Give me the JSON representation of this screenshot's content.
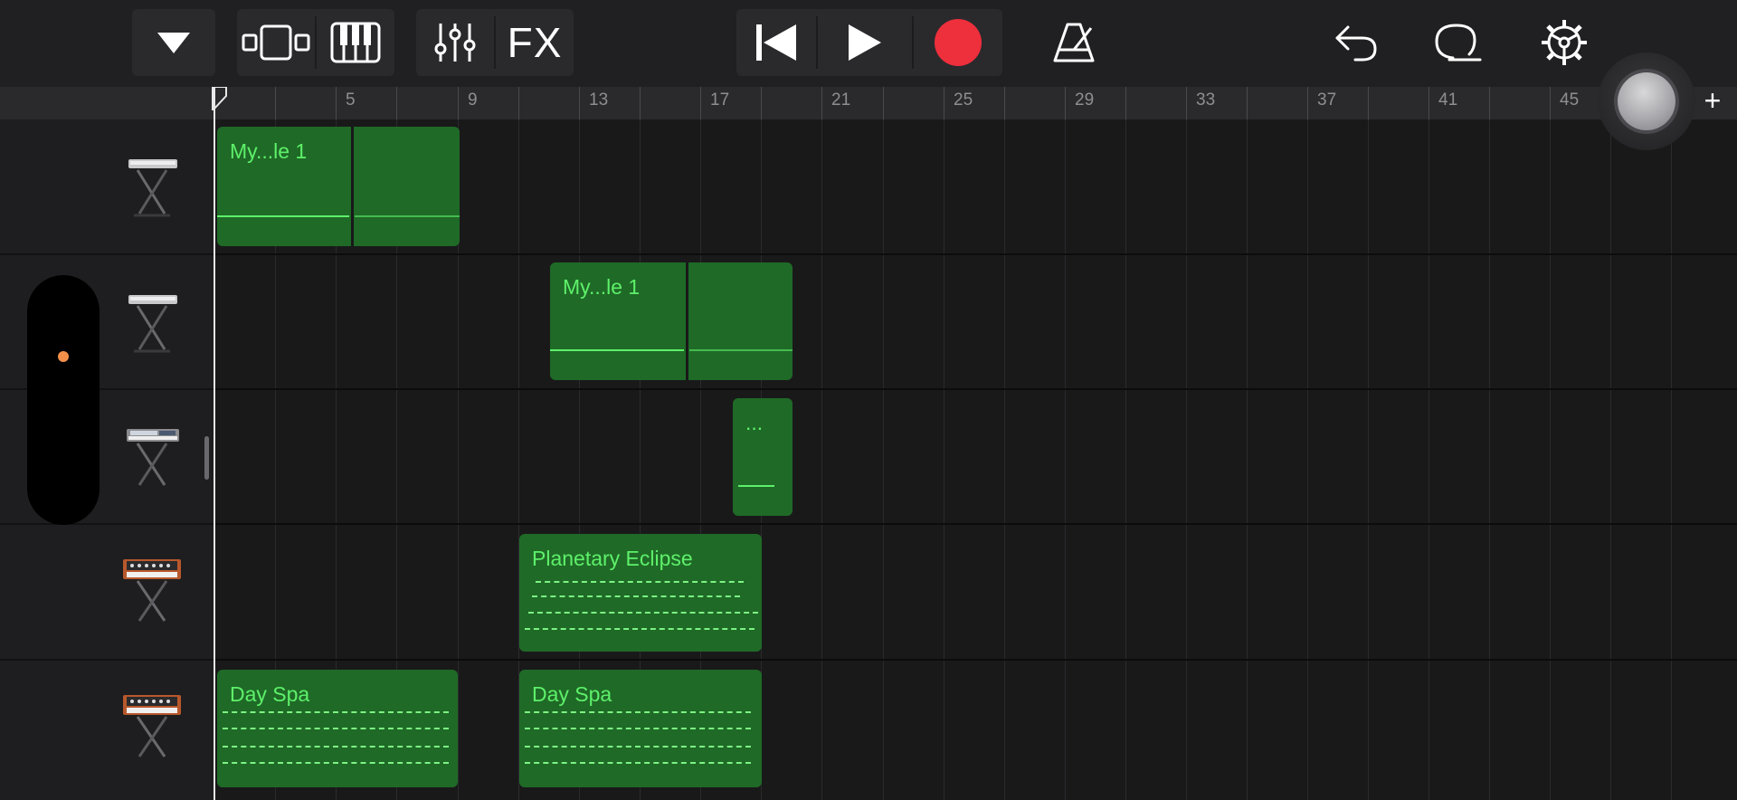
{
  "toolbar": {
    "fx_label": "FX",
    "record_color": "#ee2f3c",
    "icons": [
      "dropdown-icon",
      "tracks-view-icon",
      "keyboard-icon",
      "mixer-icon",
      "fx-icon",
      "rewind-icon",
      "play-icon",
      "record-icon",
      "metronome-icon",
      "undo-icon",
      "loop-browser-icon",
      "settings-icon"
    ]
  },
  "ruler": {
    "labels": [
      "5",
      "9",
      "13",
      "17",
      "21",
      "25",
      "29",
      "33",
      "37",
      "41",
      "45"
    ]
  },
  "tracks": [
    {
      "instrument": "keyboard-stand-icon",
      "regions": [
        {
          "name": "My...le 1"
        }
      ]
    },
    {
      "instrument": "keyboard-stand-icon",
      "regions": [
        {
          "name": "My...le 1"
        }
      ]
    },
    {
      "instrument": "synth-keyboard-icon",
      "regions": [
        {
          "name": "..."
        }
      ]
    },
    {
      "instrument": "analog-synth-icon",
      "regions": [
        {
          "name": "Planetary Eclipse"
        }
      ]
    },
    {
      "instrument": "analog-synth-icon",
      "regions": [
        {
          "name": "Day Spa"
        },
        {
          "name": "Day Spa"
        }
      ]
    }
  ],
  "add_track_label": "+",
  "colors": {
    "region_fill": "#1f6a27",
    "region_text": "#5ef06a",
    "slider_dot": "#f2904a"
  }
}
